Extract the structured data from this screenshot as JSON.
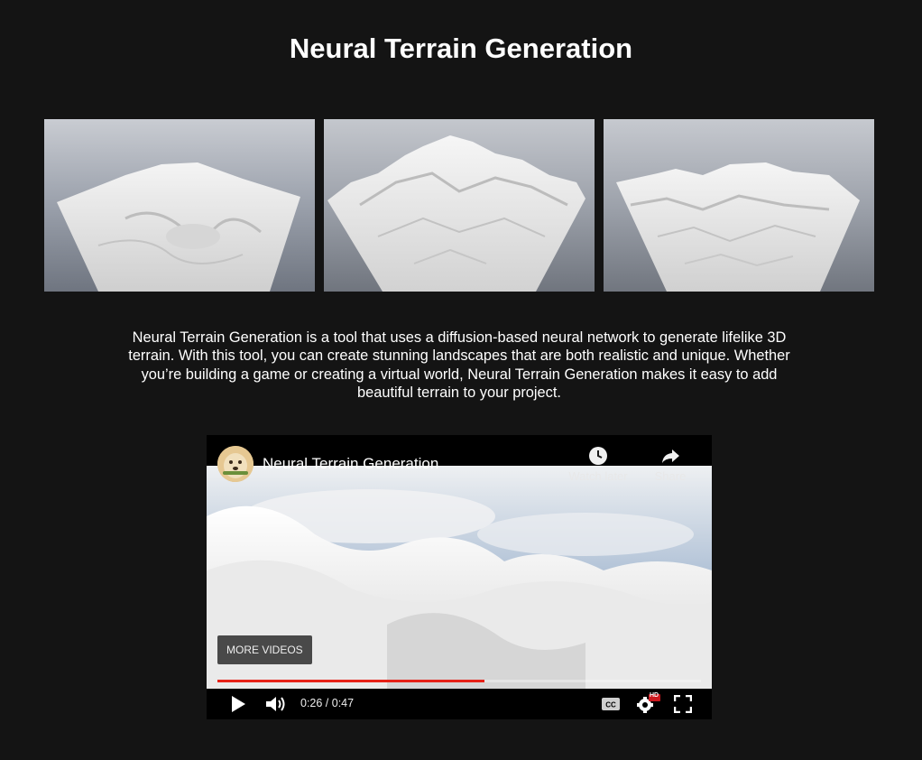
{
  "page": {
    "title": "Neural Terrain Generation",
    "description": "Neural Terrain Generation is a tool that uses a diffusion-based neural network to generate lifelike 3D terrain. With this tool, you can create stunning landscapes that are both realistic and unique. Whether you’re building a game or creating a virtual world, Neural Terrain Generation makes it easy to add beautiful terrain to your project."
  },
  "gallery": {
    "images": [
      {
        "name": "terrain-render-1"
      },
      {
        "name": "terrain-render-2"
      },
      {
        "name": "terrain-render-3"
      }
    ]
  },
  "video": {
    "title": "Neural Terrain Generation",
    "watch_later_label": "Watch later",
    "share_label": "Share",
    "more_videos_label": "MORE VIDEOS",
    "current_time": "0:26",
    "duration": "0:47",
    "time_display": "0:26 / 0:47",
    "progress_fraction": 0.553,
    "hd_badge": "HD",
    "icons": [
      "play-icon",
      "volume-icon",
      "captions-icon",
      "settings-icon",
      "fullscreen-icon",
      "clock-icon",
      "share-icon"
    ]
  },
  "colors": {
    "background": "#141414",
    "progress": "#e62117",
    "text": "#ffffff"
  }
}
